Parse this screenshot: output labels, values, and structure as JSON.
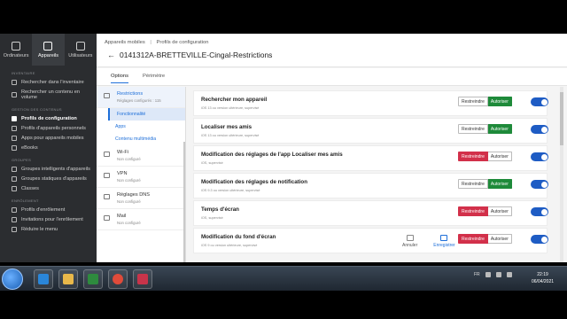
{
  "topnav": {
    "items": [
      {
        "label": "Ordinateurs"
      },
      {
        "label": "Appareils"
      },
      {
        "label": "Utilisateurs"
      }
    ]
  },
  "sidebar": {
    "sections": [
      {
        "title": "INVENTAIRE",
        "items": [
          "Rechercher dans l'inventaire",
          "Rechercher un contenu en volume"
        ]
      },
      {
        "title": "GESTION DES CONTENUS",
        "items": [
          "Profils de configuration",
          "Profils d'appareils personnels",
          "Apps pour appareils mobiles",
          "eBooks"
        ]
      },
      {
        "title": "GROUPES",
        "items": [
          "Groupes intelligents d'appareils",
          "Groupes statiques d'appareils",
          "Classes"
        ]
      },
      {
        "title": "ENRÔLEMENT",
        "items": [
          "Profils d'enrôlement",
          "Invitations pour l'enrôlement",
          "Réduire le menu"
        ]
      }
    ]
  },
  "header": {
    "breadcrumb": [
      "Appareils mobiles",
      "|",
      "Profils de configuration"
    ],
    "back_icon": "←",
    "title": "0141312A-BRETTEVILLE-Cingal-Restrictions"
  },
  "tabs": [
    {
      "label": "Options"
    },
    {
      "label": "Périmètre"
    }
  ],
  "panel": {
    "groups": [
      {
        "title": "Restrictions",
        "subtitle": "Réglages configurés : 115",
        "subitems": [
          "Fonctionnalité",
          "Apps",
          "Contenu multimédia"
        ]
      },
      {
        "title": "Wi-Fi",
        "subtitle": "Non configuré"
      },
      {
        "title": "VPN",
        "subtitle": "Non configuré"
      },
      {
        "title": "Réglages DNS",
        "subtitle": "Non configuré"
      },
      {
        "title": "Mail",
        "subtitle": "Non configuré"
      }
    ]
  },
  "rows": [
    {
      "title": "Rechercher mon appareil",
      "subtitle": "iOS 13 ou version ultérieure, supervisé",
      "restrict": "Restreindre",
      "allow": "Autoriser",
      "state": "allow"
    },
    {
      "title": "Localiser mes amis",
      "subtitle": "iOS 13 ou version ultérieure, supervisé",
      "restrict": "Restreindre",
      "allow": "Autoriser",
      "state": "allow"
    },
    {
      "title": "Modification des réglages de l'app Localiser mes amis",
      "subtitle": "iOS, supervisé",
      "restrict": "Restreindre",
      "allow": "Autoriser",
      "state": "restrict"
    },
    {
      "title": "Modification des réglages de notification",
      "subtitle": "iOS 9.3 ou version ultérieure, supervisé",
      "restrict": "Restreindre",
      "allow": "Autoriser",
      "state": "allow"
    },
    {
      "title": "Temps d'écran",
      "subtitle": "iOS, supervisé",
      "restrict": "Restreindre",
      "allow": "Autoriser",
      "state": "restrict"
    },
    {
      "title": "Modification du fond d'écran",
      "subtitle": "iOS 9 ou version ultérieure, supervisé",
      "restrict": "Restreindre",
      "allow": "Autoriser",
      "state": "restrict"
    }
  ],
  "actions": {
    "cancel": "Annuler",
    "save": "Enregistrer"
  },
  "taskbar": {
    "language": "FR",
    "time": "22:19",
    "date": "06/04/2021"
  },
  "colors": {
    "accent": "#1e6fd9",
    "allow": "#1e8a3a",
    "restrict": "#d2304a",
    "sidebar": "#2b2d30"
  }
}
